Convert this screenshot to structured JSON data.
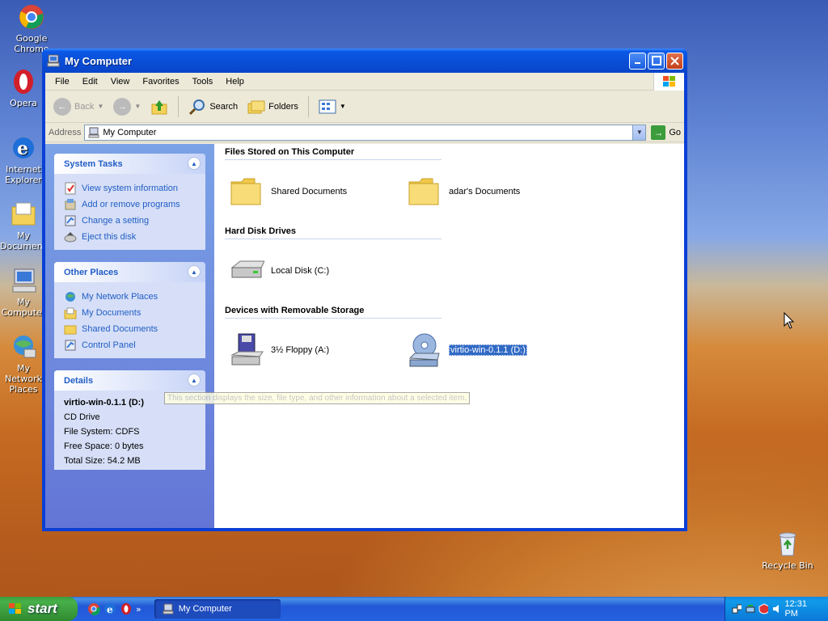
{
  "desktop": {
    "icons": [
      {
        "label": "Google Chrome",
        "icon": "chrome-icon"
      },
      {
        "label": "Opera",
        "icon": "opera-icon"
      },
      {
        "label": "Internet Explorer",
        "icon": "ie-icon"
      },
      {
        "label": "My Documents",
        "icon": "my-documents-icon"
      },
      {
        "label": "My Computer",
        "icon": "my-computer-icon"
      },
      {
        "label": "My Network Places",
        "icon": "network-places-icon"
      },
      {
        "label": "Recycle Bin",
        "icon": "recycle-bin-icon"
      }
    ]
  },
  "window": {
    "title": "My Computer",
    "menu": [
      "File",
      "Edit",
      "View",
      "Favorites",
      "Tools",
      "Help"
    ],
    "toolbar": {
      "back": "Back",
      "search": "Search",
      "folders": "Folders"
    },
    "address": {
      "label": "Address",
      "value": "My Computer",
      "go": "Go"
    },
    "system_tasks": {
      "title": "System Tasks",
      "items": [
        "View system information",
        "Add or remove programs",
        "Change a setting",
        "Eject this disk"
      ]
    },
    "other_places": {
      "title": "Other Places",
      "items": [
        "My Network Places",
        "My Documents",
        "Shared Documents",
        "Control Panel"
      ]
    },
    "details": {
      "title": "Details",
      "name": "virtio-win-0.1.1 (D:)",
      "type": "CD Drive",
      "filesystem": "File System: CDFS",
      "free": "Free Space: 0 bytes",
      "total": "Total Size: 54.2 MB"
    },
    "groups": {
      "files": {
        "title": "Files Stored on This Computer",
        "items": [
          "Shared Documents",
          "adar's Documents"
        ]
      },
      "hdd": {
        "title": "Hard Disk Drives",
        "items": [
          "Local Disk (C:)"
        ]
      },
      "removable": {
        "title": "Devices with Removable Storage",
        "items": [
          "3½ Floppy (A:)",
          "virtio-win-0.1.1 (D:)"
        ]
      }
    },
    "tooltip": "This section displays the size, file type, and other information about a selected item."
  },
  "taskbar": {
    "start": "start",
    "task": "My Computer",
    "clock": "12:31 PM"
  }
}
